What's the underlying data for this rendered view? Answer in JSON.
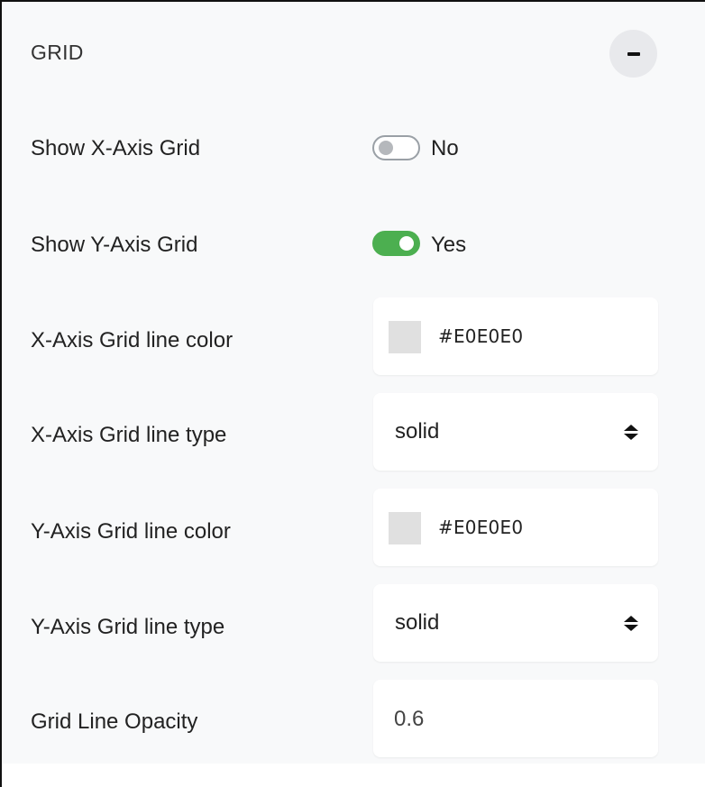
{
  "section": {
    "title": "GRID",
    "collapse_icon": "minus-icon"
  },
  "show_x_grid": {
    "label": "Show X-Axis Grid",
    "enabled": false,
    "state_text": "No"
  },
  "show_y_grid": {
    "label": "Show Y-Axis Grid",
    "enabled": true,
    "state_text": "Yes"
  },
  "x_grid_color": {
    "label": "X-Axis Grid line color",
    "value": "#E0E0E0",
    "swatch_color": "#E0E0E0"
  },
  "x_grid_type": {
    "label": "X-Axis Grid line type",
    "value": "solid",
    "icon": "sort-updown-icon"
  },
  "y_grid_color": {
    "label": "Y-Axis Grid line color",
    "value": "#E0E0E0",
    "swatch_color": "#E0E0E0"
  },
  "y_grid_type": {
    "label": "Y-Axis Grid line type",
    "value": "solid",
    "icon": "sort-updown-icon"
  },
  "opacity": {
    "label": "Grid Line Opacity",
    "value": "0.6"
  },
  "colors": {
    "toggle_on": "#4CAF50",
    "toggle_off_border": "#9AA0A6",
    "panel_background": "#F8F9FA"
  }
}
